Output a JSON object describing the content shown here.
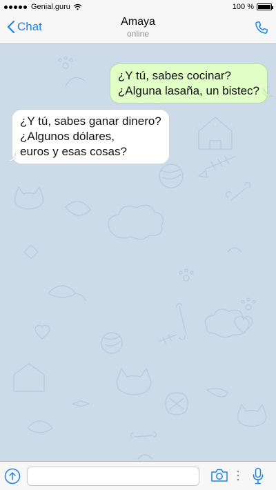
{
  "status_bar": {
    "carrier": "Genial.guru",
    "time": "",
    "battery_text": "100 %",
    "battery_level": 1.0,
    "signal_icon": "signal-dots-icon",
    "wifi_icon": "wifi-icon"
  },
  "header": {
    "back_label": "Chat",
    "contact_name": "Amaya",
    "contact_status": "online",
    "back_icon": "chevron-left-icon",
    "call_icon": "phone-icon"
  },
  "messages": [
    {
      "direction": "outgoing",
      "lines": [
        "¿Y tú, sabes cocinar?",
        "¿Alguna lasaña, un bistec?"
      ]
    },
    {
      "direction": "incoming",
      "lines": [
        "¿Y tú, sabes ganar dinero?",
        "¿Algunos dólares,",
        "euros y esas cosas?"
      ]
    }
  ],
  "composer": {
    "placeholder": "",
    "value": "",
    "attach_icon": "attach-arrow-icon",
    "camera_icon": "camera-icon",
    "more_icon": "vertical-dots-icon",
    "mic_icon": "microphone-icon"
  },
  "colors": {
    "accent": "#1c82e6",
    "chat_background": "#cddbe8",
    "outgoing_bubble": "#e1fec6",
    "incoming_bubble": "#ffffff",
    "bar_background": "#f7f7f7"
  }
}
